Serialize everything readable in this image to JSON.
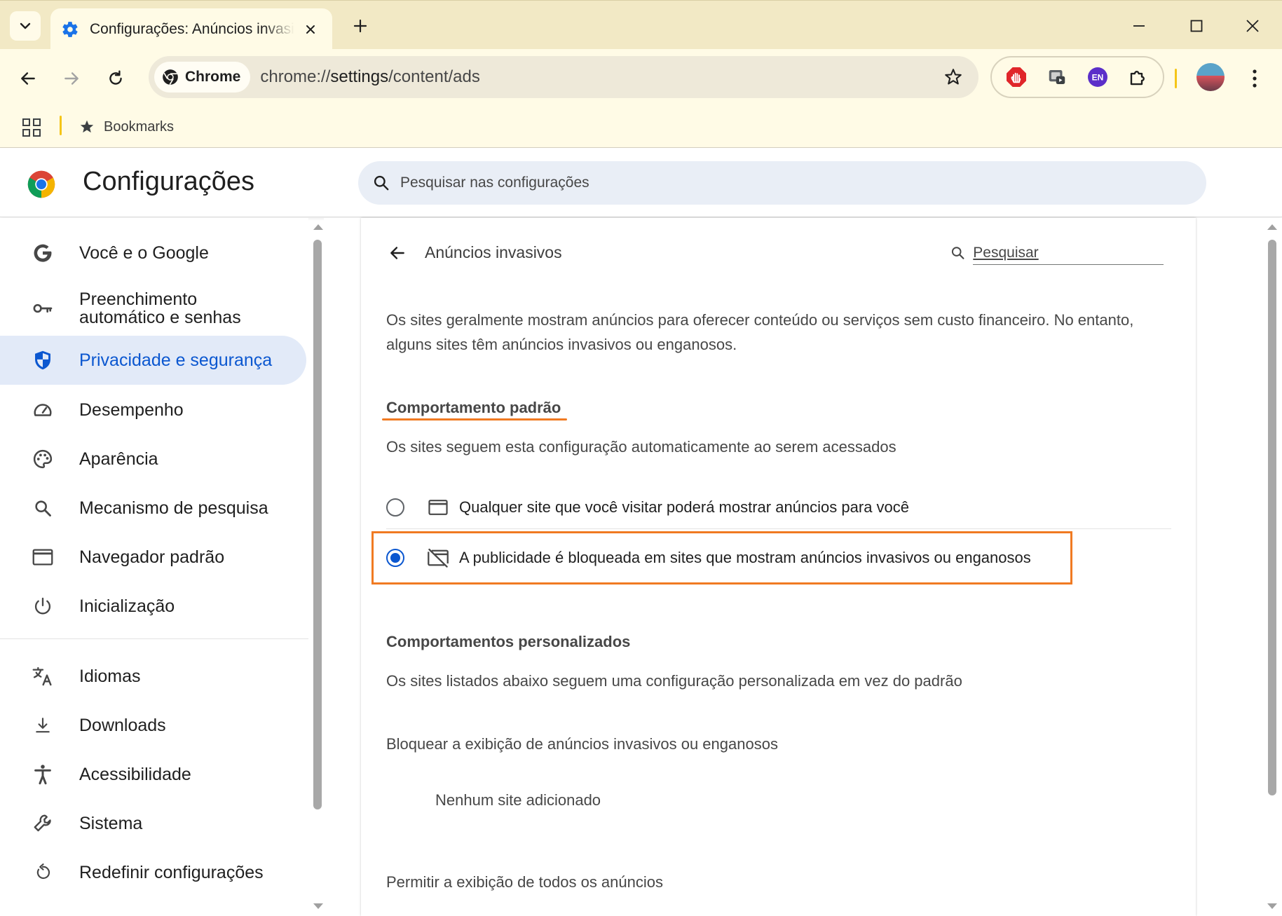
{
  "window": {
    "tab_title": "Configurações: Anúncios invasivos",
    "new_tab_symbol": "+",
    "controls": [
      "minimize-icon",
      "maximize-icon",
      "close-icon"
    ]
  },
  "toolbar": {
    "chip_label": "Chrome",
    "url_prefix": "chrome://",
    "url_host": "settings",
    "url_path": "/content/ads",
    "extensions": [
      "adblock-icon",
      "extension-icon",
      "language-icon",
      "puzzle-icon"
    ],
    "language_ext_label": "EN"
  },
  "bookmarks": {
    "label": "Bookmarks"
  },
  "settings": {
    "title": "Configurações",
    "search_placeholder": "Pesquisar nas configurações"
  },
  "sidebar": {
    "items": [
      {
        "label": "Você e o Google",
        "icon": "google-icon"
      },
      {
        "label": "Preenchimento automático e senhas",
        "icon": "key-icon"
      },
      {
        "label": "Privacidade e segurança",
        "icon": "shield-icon",
        "active": true
      },
      {
        "label": "Desempenho",
        "icon": "speedometer-icon"
      },
      {
        "label": "Aparência",
        "icon": "palette-icon"
      },
      {
        "label": "Mecanismo de pesquisa",
        "icon": "search-icon"
      },
      {
        "label": "Navegador padrão",
        "icon": "browser-window-icon"
      },
      {
        "label": "Inicialização",
        "icon": "power-icon"
      },
      {
        "label": "Idiomas",
        "icon": "translate-icon"
      },
      {
        "label": "Downloads",
        "icon": "download-icon"
      },
      {
        "label": "Acessibilidade",
        "icon": "accessibility-icon"
      },
      {
        "label": "Sistema",
        "icon": "wrench-icon"
      },
      {
        "label": "Redefinir configurações",
        "icon": "reset-icon"
      }
    ]
  },
  "page": {
    "title": "Anúncios invasivos",
    "search_placeholder": "Pesquisar",
    "description": "Os sites geralmente mostram anúncios para oferecer conteúdo ou serviços sem custo financeiro. No entanto, alguns sites têm anúncios invasivos ou enganosos.",
    "default_behavior": {
      "heading": "Comportamento padrão",
      "subheading": "Os sites seguem esta configuração automaticamente ao serem acessados",
      "options": [
        {
          "label": "Qualquer site que você visitar poderá mostrar anúncios para você",
          "icon": "ads-allowed-icon",
          "selected": false
        },
        {
          "label": "A publicidade é bloqueada em sites que mostram anúncios invasivos ou enganosos",
          "icon": "ads-blocked-icon",
          "selected": true
        }
      ]
    },
    "custom_behavior": {
      "heading": "Comportamentos personalizados",
      "subheading": "Os sites listados abaixo seguem uma configuração personalizada em vez do padrão",
      "block_label": "Bloquear a exibição de anúncios invasivos ou enganosos",
      "empty_label": "Nenhum site adicionado",
      "allow_label": "Permitir a exibição de todos os anúncios"
    }
  },
  "colors": {
    "accent": "#0b57d0",
    "highlight": "#f07a22",
    "tabstrip": "#f2e9c5"
  }
}
